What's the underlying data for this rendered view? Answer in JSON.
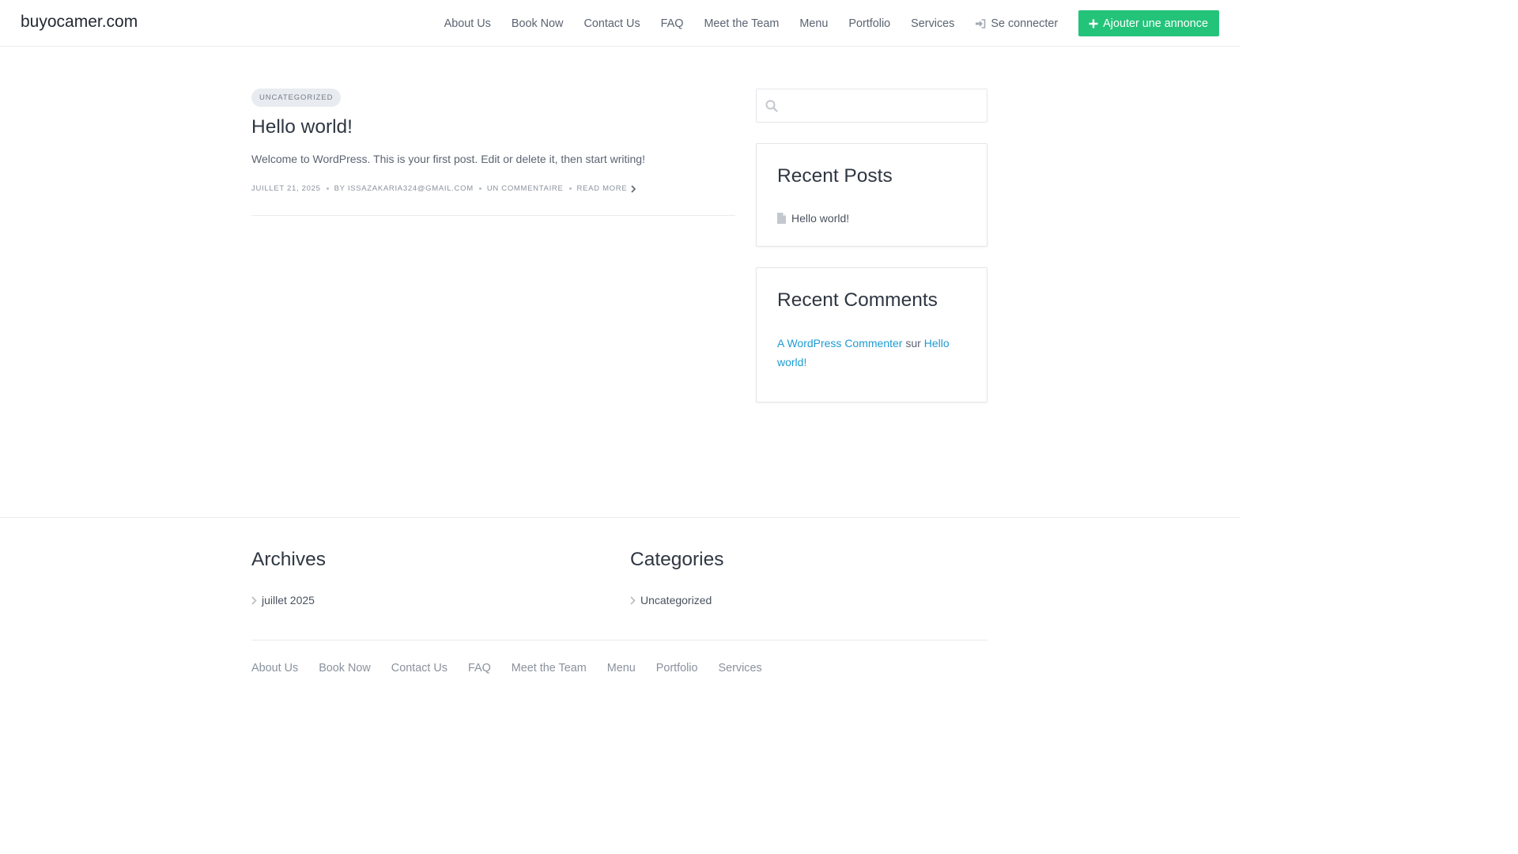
{
  "header": {
    "site_title": "buyocamer.com",
    "nav": [
      "About Us",
      "Book Now",
      "Contact Us",
      "FAQ",
      "Meet the Team",
      "Menu",
      "Portfolio",
      "Services"
    ],
    "login_label": "Se connecter",
    "login_icon": "sign-in-icon",
    "add_button_label": "Ajouter une annonce",
    "add_button_icon": "plus-icon",
    "accent_color": "#24c37a"
  },
  "post": {
    "category": "UNCATEGORIZED",
    "title": "Hello world!",
    "excerpt": "Welcome to WordPress. This is your first post. Edit or delete it, then start writing!",
    "date": "JUILLET 21, 2025",
    "author": "BY ISSAZAKARIA324@GMAIL.COM",
    "comments": "UN COMMENTAIRE",
    "read_more": "READ MORE"
  },
  "sidebar": {
    "search": {
      "placeholder": "",
      "icon": "search-icon"
    },
    "recent_posts": {
      "title": "Recent Posts",
      "items": [
        "Hello world!"
      ],
      "icon": "file-icon"
    },
    "recent_comments": {
      "title": "Recent Comments",
      "author": "A WordPress Commenter",
      "connector": "sur",
      "post": "Hello world!",
      "link_color": "#1e9bd1"
    }
  },
  "footer": {
    "archives": {
      "title": "Archives",
      "items": [
        "juillet 2025"
      ]
    },
    "categories": {
      "title": "Categories",
      "items": [
        "Uncategorized"
      ]
    },
    "nav": [
      "About Us",
      "Book Now",
      "Contact Us",
      "FAQ",
      "Meet the Team",
      "Menu",
      "Portfolio",
      "Services"
    ]
  }
}
